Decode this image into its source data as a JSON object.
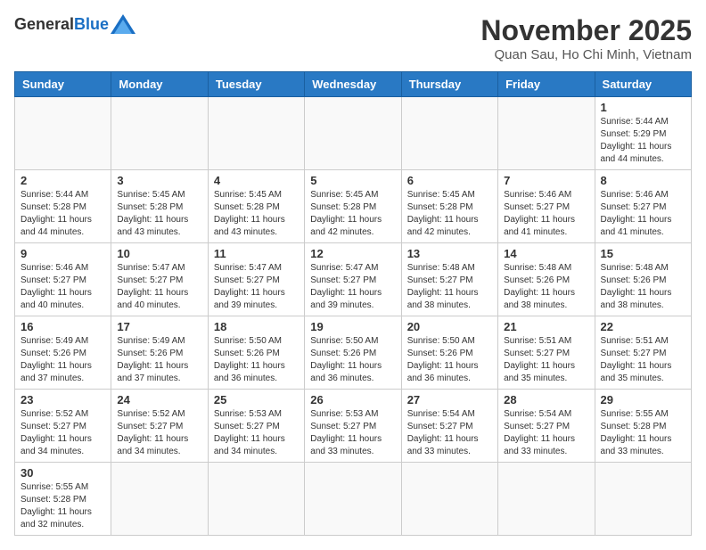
{
  "header": {
    "logo_general": "General",
    "logo_blue": "Blue",
    "month_title": "November 2025",
    "location": "Quan Sau, Ho Chi Minh, Vietnam"
  },
  "weekdays": [
    "Sunday",
    "Monday",
    "Tuesday",
    "Wednesday",
    "Thursday",
    "Friday",
    "Saturday"
  ],
  "weeks": [
    [
      {
        "day": "",
        "info": ""
      },
      {
        "day": "",
        "info": ""
      },
      {
        "day": "",
        "info": ""
      },
      {
        "day": "",
        "info": ""
      },
      {
        "day": "",
        "info": ""
      },
      {
        "day": "",
        "info": ""
      },
      {
        "day": "1",
        "info": "Sunrise: 5:44 AM\nSunset: 5:29 PM\nDaylight: 11 hours and 44 minutes."
      }
    ],
    [
      {
        "day": "2",
        "info": "Sunrise: 5:44 AM\nSunset: 5:28 PM\nDaylight: 11 hours and 44 minutes."
      },
      {
        "day": "3",
        "info": "Sunrise: 5:45 AM\nSunset: 5:28 PM\nDaylight: 11 hours and 43 minutes."
      },
      {
        "day": "4",
        "info": "Sunrise: 5:45 AM\nSunset: 5:28 PM\nDaylight: 11 hours and 43 minutes."
      },
      {
        "day": "5",
        "info": "Sunrise: 5:45 AM\nSunset: 5:28 PM\nDaylight: 11 hours and 42 minutes."
      },
      {
        "day": "6",
        "info": "Sunrise: 5:45 AM\nSunset: 5:28 PM\nDaylight: 11 hours and 42 minutes."
      },
      {
        "day": "7",
        "info": "Sunrise: 5:46 AM\nSunset: 5:27 PM\nDaylight: 11 hours and 41 minutes."
      },
      {
        "day": "8",
        "info": "Sunrise: 5:46 AM\nSunset: 5:27 PM\nDaylight: 11 hours and 41 minutes."
      }
    ],
    [
      {
        "day": "9",
        "info": "Sunrise: 5:46 AM\nSunset: 5:27 PM\nDaylight: 11 hours and 40 minutes."
      },
      {
        "day": "10",
        "info": "Sunrise: 5:47 AM\nSunset: 5:27 PM\nDaylight: 11 hours and 40 minutes."
      },
      {
        "day": "11",
        "info": "Sunrise: 5:47 AM\nSunset: 5:27 PM\nDaylight: 11 hours and 39 minutes."
      },
      {
        "day": "12",
        "info": "Sunrise: 5:47 AM\nSunset: 5:27 PM\nDaylight: 11 hours and 39 minutes."
      },
      {
        "day": "13",
        "info": "Sunrise: 5:48 AM\nSunset: 5:27 PM\nDaylight: 11 hours and 38 minutes."
      },
      {
        "day": "14",
        "info": "Sunrise: 5:48 AM\nSunset: 5:26 PM\nDaylight: 11 hours and 38 minutes."
      },
      {
        "day": "15",
        "info": "Sunrise: 5:48 AM\nSunset: 5:26 PM\nDaylight: 11 hours and 38 minutes."
      }
    ],
    [
      {
        "day": "16",
        "info": "Sunrise: 5:49 AM\nSunset: 5:26 PM\nDaylight: 11 hours and 37 minutes."
      },
      {
        "day": "17",
        "info": "Sunrise: 5:49 AM\nSunset: 5:26 PM\nDaylight: 11 hours and 37 minutes."
      },
      {
        "day": "18",
        "info": "Sunrise: 5:50 AM\nSunset: 5:26 PM\nDaylight: 11 hours and 36 minutes."
      },
      {
        "day": "19",
        "info": "Sunrise: 5:50 AM\nSunset: 5:26 PM\nDaylight: 11 hours and 36 minutes."
      },
      {
        "day": "20",
        "info": "Sunrise: 5:50 AM\nSunset: 5:26 PM\nDaylight: 11 hours and 36 minutes."
      },
      {
        "day": "21",
        "info": "Sunrise: 5:51 AM\nSunset: 5:27 PM\nDaylight: 11 hours and 35 minutes."
      },
      {
        "day": "22",
        "info": "Sunrise: 5:51 AM\nSunset: 5:27 PM\nDaylight: 11 hours and 35 minutes."
      }
    ],
    [
      {
        "day": "23",
        "info": "Sunrise: 5:52 AM\nSunset: 5:27 PM\nDaylight: 11 hours and 34 minutes."
      },
      {
        "day": "24",
        "info": "Sunrise: 5:52 AM\nSunset: 5:27 PM\nDaylight: 11 hours and 34 minutes."
      },
      {
        "day": "25",
        "info": "Sunrise: 5:53 AM\nSunset: 5:27 PM\nDaylight: 11 hours and 34 minutes."
      },
      {
        "day": "26",
        "info": "Sunrise: 5:53 AM\nSunset: 5:27 PM\nDaylight: 11 hours and 33 minutes."
      },
      {
        "day": "27",
        "info": "Sunrise: 5:54 AM\nSunset: 5:27 PM\nDaylight: 11 hours and 33 minutes."
      },
      {
        "day": "28",
        "info": "Sunrise: 5:54 AM\nSunset: 5:27 PM\nDaylight: 11 hours and 33 minutes."
      },
      {
        "day": "29",
        "info": "Sunrise: 5:55 AM\nSunset: 5:28 PM\nDaylight: 11 hours and 33 minutes."
      }
    ],
    [
      {
        "day": "30",
        "info": "Sunrise: 5:55 AM\nSunset: 5:28 PM\nDaylight: 11 hours and 32 minutes."
      },
      {
        "day": "",
        "info": ""
      },
      {
        "day": "",
        "info": ""
      },
      {
        "day": "",
        "info": ""
      },
      {
        "day": "",
        "info": ""
      },
      {
        "day": "",
        "info": ""
      },
      {
        "day": "",
        "info": ""
      }
    ]
  ]
}
